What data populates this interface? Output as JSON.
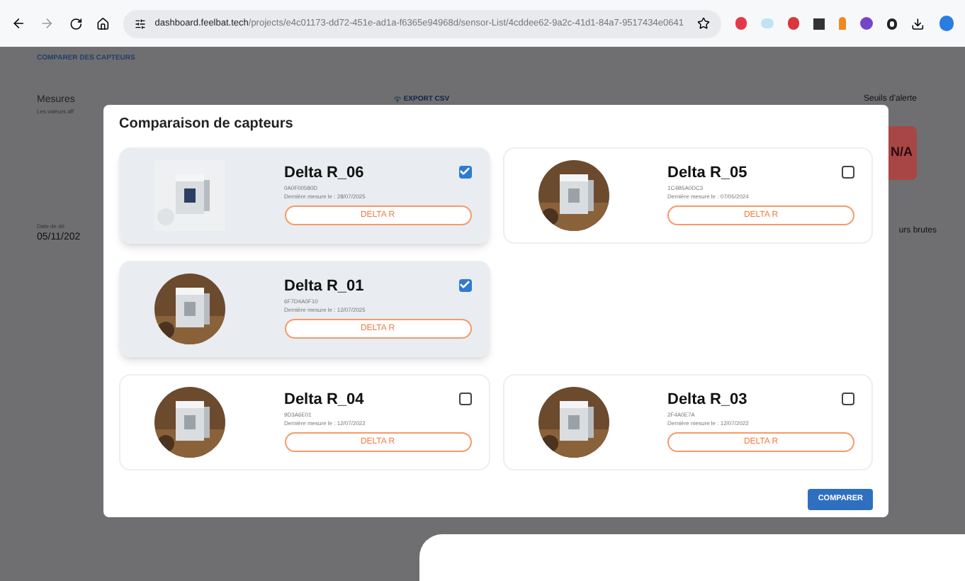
{
  "browser": {
    "url_host": "dashboard.feelbat.tech",
    "url_path": "/projects/e4c01173-dd72-451e-ad1a-f6365e94968d/sensor-List/4cddee62-9a2c-41d1-84a7-9517434e0641"
  },
  "page": {
    "breadcrumb": "COMPARER DES CAPTEURS",
    "measures_title": "Mesures",
    "measures_subtitle": "Les valeurs aff",
    "export": "EXPORT CSV",
    "thresholds_title": "Seuils d'alerte",
    "alert_value": "N/A",
    "date_label": "Date de dé",
    "date_value": "05/11/202",
    "raw_title": "urs brutes"
  },
  "modal": {
    "title": "Comparaison de capteurs",
    "rows": [
      [
        {
          "name": "Delta R_06",
          "serial": "0A0F00580D",
          "last": "Dernière mesure le : 28/07/2025",
          "button": "DELTA R",
          "checked": true,
          "kind": "square"
        },
        {
          "name": "Delta R_05",
          "serial": "1C4B5A0DC3",
          "last": "Dernière mesure le : 07/05/2024",
          "button": "DELTA R",
          "checked": false,
          "kind": "round"
        }
      ],
      [
        {
          "name": "Delta R_01",
          "serial": "6F7D4A0F10",
          "last": "Dernière mesure le : 12/07/2025",
          "button": "DELTA R",
          "checked": true,
          "kind": "round"
        }
      ],
      [
        {
          "name": "Delta R_04",
          "serial": "9D3A6E01",
          "last": "Dernière mesure le : 12/07/2022",
          "button": "DELTA R",
          "checked": false,
          "kind": "round"
        },
        {
          "name": "Delta R_03",
          "serial": "2F4A0E7A",
          "last": "Dernière mesure le : 12/07/2022",
          "button": "DELTA R",
          "checked": false,
          "kind": "round"
        }
      ]
    ],
    "compare": "COMPARER"
  }
}
